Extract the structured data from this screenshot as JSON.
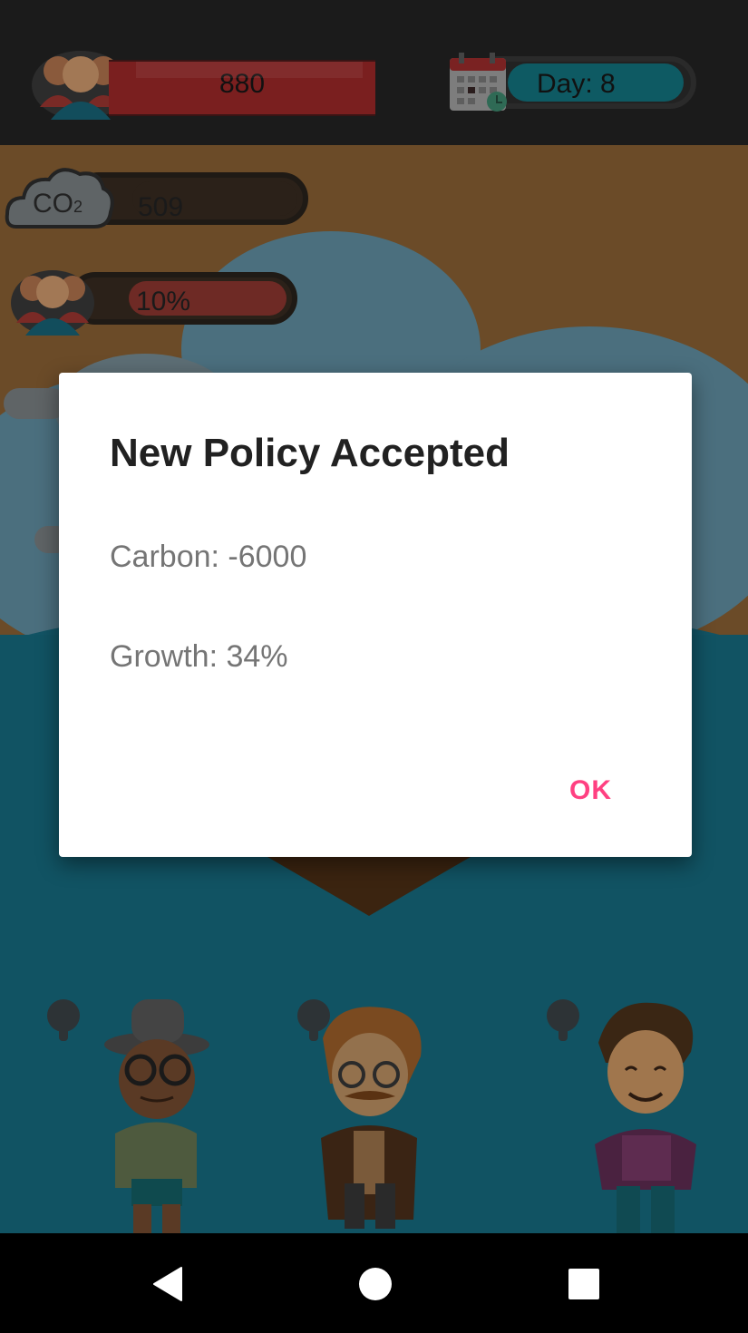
{
  "hud": {
    "population": "880",
    "day": "Day: 8",
    "co2_label": "CO",
    "co2_sub": "2",
    "co2_value": "509",
    "approval": "10%"
  },
  "dialog": {
    "title": "New Policy Accepted",
    "carbon": "Carbon: -6000",
    "growth": "Growth: 34%",
    "ok_label": "OK"
  },
  "colors": {
    "accent": "#ff4081",
    "title": "#212121",
    "body_text": "#757575"
  },
  "icons": {
    "back": "back-triangle-icon",
    "home": "home-circle-icon",
    "recents": "recents-square-icon"
  }
}
